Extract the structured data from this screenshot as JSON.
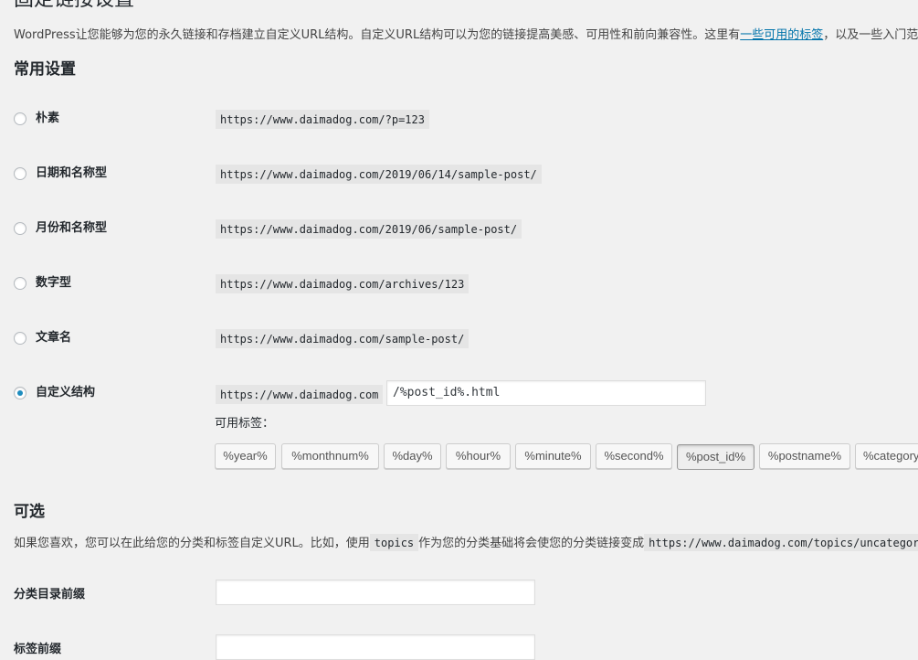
{
  "page": {
    "title": "固定链接设置",
    "intro_text": "WordPress让您能够为您的永久链接和存档建立自定义URL结构。自定义URL结构可以为您的链接提高美感、可用性和前向兼容性。这里有",
    "intro_link": "一些可用的标签",
    "intro_after": "，以及一些入门范例。"
  },
  "common": {
    "heading": "常用设置",
    "options": [
      {
        "label": "朴素",
        "example": "https://www.daimadog.com/?p=123",
        "checked": false
      },
      {
        "label": "日期和名称型",
        "example": "https://www.daimadog.com/2019/06/14/sample-post/",
        "checked": false
      },
      {
        "label": "月份和名称型",
        "example": "https://www.daimadog.com/2019/06/sample-post/",
        "checked": false
      },
      {
        "label": "数字型",
        "example": "https://www.daimadog.com/archives/123",
        "checked": false
      },
      {
        "label": "文章名",
        "example": "https://www.daimadog.com/sample-post/",
        "checked": false
      }
    ],
    "custom": {
      "label": "自定义结构",
      "checked": true,
      "base": "https://www.daimadog.com",
      "value": "/%post_id%.html",
      "tags_label": "可用标签：",
      "tags": [
        "%year%",
        "%monthnum%",
        "%day%",
        "%hour%",
        "%minute%",
        "%second%",
        "%post_id%",
        "%postname%",
        "%category%"
      ],
      "active_tag": "%post_id%"
    }
  },
  "optional": {
    "heading": "可选",
    "desc_1": "如果您喜欢，您可以在此给您的分类和标签自定义URL。比如，使用",
    "desc_code_1": "topics",
    "desc_2": "作为您的分类基础将会使您的分类链接变成",
    "desc_code_2": "https://www.daimadog.com/topics/uncategorized/",
    "category_base_label": "分类目录前缀",
    "category_base_value": "",
    "tag_base_label": "标签前缀",
    "tag_base_value": ""
  },
  "colors": {
    "background": "#f1f1f1",
    "link": "#0073aa",
    "radio_checked": "#1e8cbe",
    "code_bg": "#e5e5e5"
  }
}
